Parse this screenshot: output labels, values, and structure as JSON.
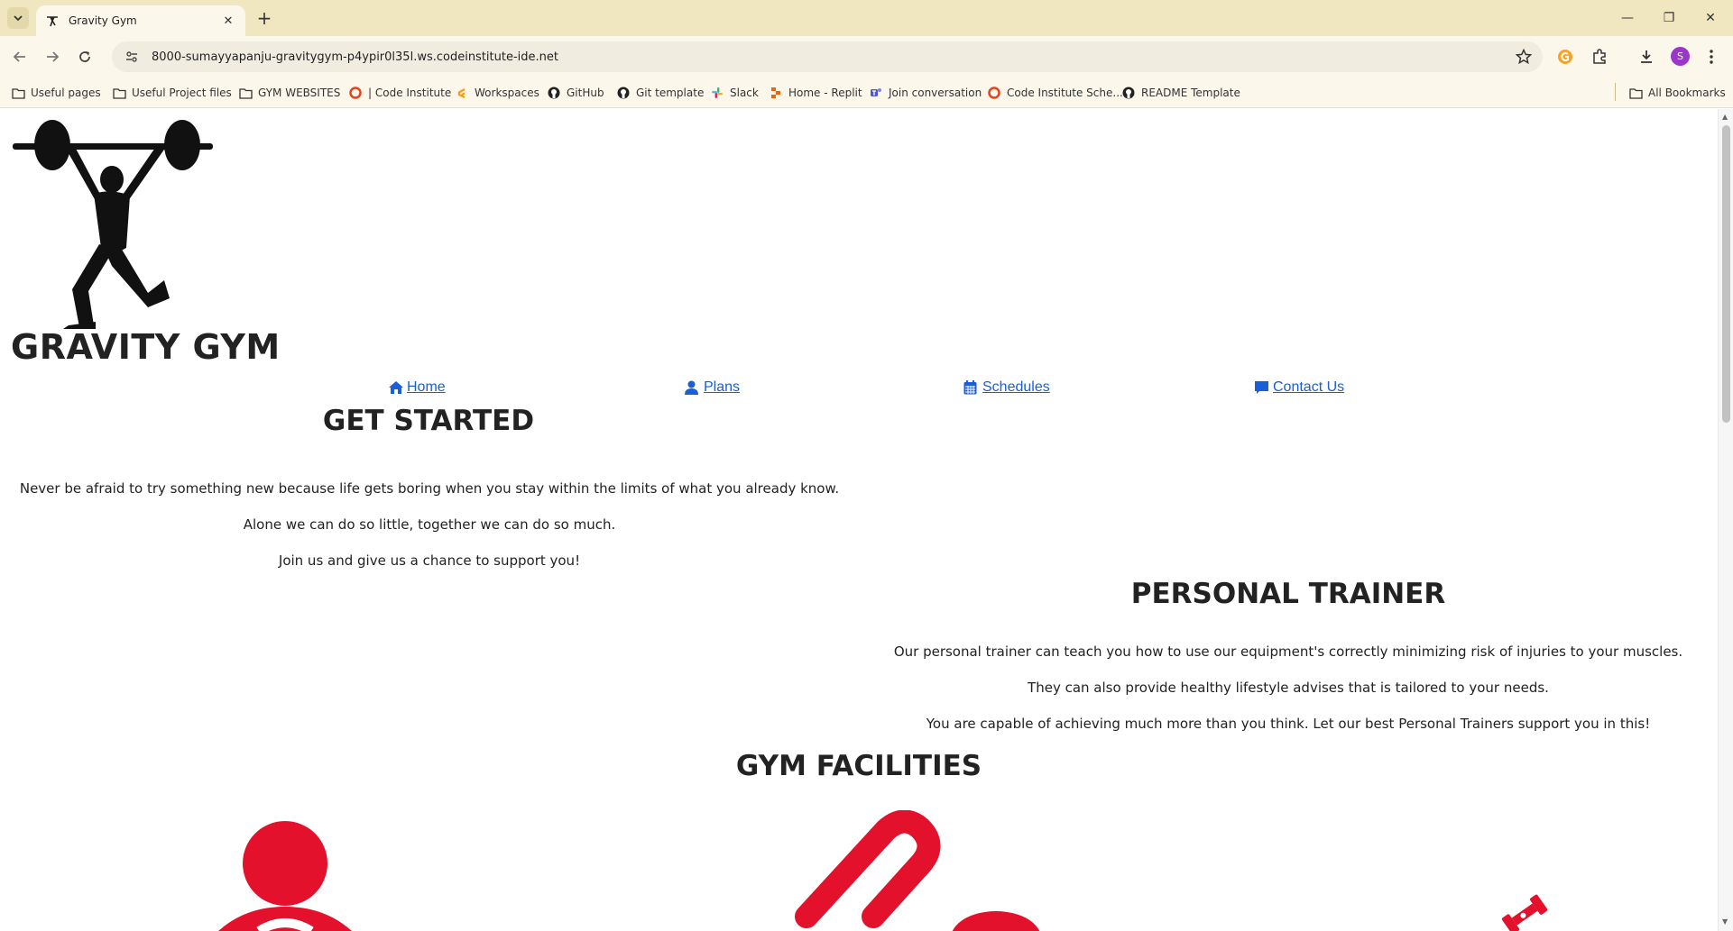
{
  "browser": {
    "tab_title": "Gravity Gym",
    "tab_close": "✕",
    "new_tab": "+",
    "url": "8000-sumayyapanju-gravitygym-p4ypir0l35l.ws.codeinstitute-ide.net",
    "profile_initial": "S",
    "window_controls": {
      "minimize": "—",
      "restore": "❐",
      "close": "✕"
    },
    "bookmarks": [
      {
        "label": "Useful pages",
        "icon": "folder-icon"
      },
      {
        "label": "Useful Project files",
        "icon": "folder-icon"
      },
      {
        "label": "GYM WEBSITES",
        "icon": "folder-icon"
      },
      {
        "label": "| Code Institute",
        "icon": "code-institute-icon"
      },
      {
        "label": "Workspaces",
        "icon": "gitpod-icon"
      },
      {
        "label": "GitHub",
        "icon": "github-icon"
      },
      {
        "label": "Git template",
        "icon": "github-icon"
      },
      {
        "label": "Slack",
        "icon": "slack-icon"
      },
      {
        "label": "Home - Replit",
        "icon": "replit-icon"
      },
      {
        "label": "Join conversation",
        "icon": "teams-icon"
      },
      {
        "label": "Code Institute Sche...",
        "icon": "code-institute-icon"
      },
      {
        "label": "README Template",
        "icon": "github-icon"
      }
    ],
    "all_bookmarks": "All Bookmarks"
  },
  "site": {
    "brand": "GRAVITY GYM",
    "nav": [
      {
        "label": " Home",
        "icon": "home-icon"
      },
      {
        "label": " Plans",
        "icon": "user-icon"
      },
      {
        "label": " Schedules",
        "icon": "calendar-icon"
      },
      {
        "label": " Contact Us",
        "icon": "comment-icon"
      }
    ],
    "get_started": {
      "heading": "GET STARTED",
      "lines": [
        "Never be afraid to try something new because life gets boring when you stay within the limits of what you already know.",
        "Alone we can do so little, together we can do so much.",
        "Join us and give us a chance to support you!"
      ]
    },
    "personal_trainer": {
      "heading": "PERSONAL TRAINER",
      "lines": [
        "Our personal trainer can teach you how to use our equipment's correctly minimizing risk of injuries to your muscles.",
        "They can also provide healthy lifestyle advises that is tailored to your needs.",
        "You are capable of achieving much more than you think. Let our best Personal Trainers support you in this!"
      ]
    },
    "facilities": {
      "heading": "GYM FACILITIES",
      "icons": [
        "person-icon",
        "treadmill-icon",
        "dumbbell-icon"
      ],
      "accent": "#e3112b"
    }
  },
  "colors": {
    "tabbar": "#f0e6c0",
    "toolbar": "#fbf7ea",
    "link": "#1a5fd6",
    "text": "#222222"
  }
}
